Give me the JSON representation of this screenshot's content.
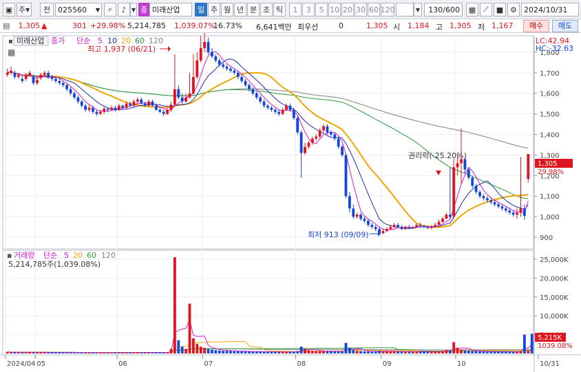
{
  "toolbar": {
    "type_label": "주",
    "jeon_label": "전",
    "code": "025560",
    "stock_badge": "종",
    "stock_name": "미래산업",
    "periods": [
      "일",
      "주",
      "월",
      "년",
      "분",
      "초",
      "틱"
    ],
    "numbers": [
      "1",
      "3",
      "5",
      "10",
      "20",
      "30",
      "60",
      "120"
    ],
    "count": "130/600",
    "date": "2024/10/31"
  },
  "quote": {
    "price": "1,305",
    "change": "301",
    "change_pct": "+29.98%",
    "volume": "5,214,785",
    "volume_pct": "1,039.07%",
    "turnover_pct": "16.73%",
    "amount": "6,641백만",
    "preferred_label": "최우선",
    "preferred_value": "0",
    "best_price": "1,305",
    "open_label": "시",
    "open": "1,184",
    "high_label": "고",
    "high": "1,305",
    "low_label": "저",
    "low": "1,167",
    "buy_label": "매수",
    "sell_label": "매도"
  },
  "price_panel": {
    "name_label": "미래산업",
    "ma_title": "종가",
    "ma_kind": "단순",
    "ma_periods": [
      "5",
      "10",
      "20",
      "60",
      "120"
    ],
    "lc": "LC:42.94",
    "hc": "HC:-32.63",
    "high_note": "최고 1,937 (06/21)",
    "low_note": "최저 913 (09/09)",
    "rights_note": "권리락(-25.20%)",
    "last_price_box": "1,305",
    "last_change_box": "29.98%"
  },
  "volume_panel": {
    "title": "거래량",
    "ma_kind": "단순",
    "ma_periods": [
      "5",
      "20",
      "60",
      "120"
    ],
    "info": "5,214,785주(1,039.08%)",
    "last_box": "5,215K",
    "last_pct_box": "1039.08%"
  },
  "colors": {
    "up": "#e0141e",
    "down": "#1446d8",
    "ma5": "#d21bd2",
    "ma10": "#1a2ea8",
    "ma20": "#f0a500",
    "ma60": "#2a9a3a",
    "ma120": "#7f7f7f"
  },
  "chart_data": [
    {
      "type": "candlestick",
      "title": "미래산업",
      "y_ticks": [
        "1,800",
        "1,700",
        "1,600",
        "1,500",
        "1,400",
        "1,300",
        "1,200",
        "1,100",
        "1,000",
        "900"
      ],
      "ylim": [
        850,
        1860
      ],
      "x_ticks": [
        "2024/04",
        "05",
        "06",
        "07",
        "08",
        "09",
        "10",
        "10/31"
      ],
      "x_tick_index": [
        0,
        8,
        30,
        53,
        78,
        101,
        121,
        140
      ],
      "n": 141,
      "closes": [
        1700,
        1710,
        1680,
        1690,
        1660,
        1690,
        1700,
        1650,
        1665,
        1690,
        1700,
        1680,
        1670,
        1660,
        1650,
        1640,
        1620,
        1600,
        1580,
        1560,
        1540,
        1520,
        1530,
        1510,
        1500,
        1510,
        1525,
        1520,
        1530,
        1520,
        1540,
        1530,
        1550,
        1540,
        1560,
        1570,
        1550,
        1540,
        1560,
        1540,
        1520,
        1510,
        1500,
        1520,
        1545,
        1620,
        1580,
        1560,
        1580,
        1600,
        1680,
        1760,
        1820,
        1850,
        1800,
        1780,
        1760,
        1740,
        1730,
        1720,
        1710,
        1700,
        1680,
        1660,
        1640,
        1620,
        1600,
        1580,
        1560,
        1540,
        1530,
        1520,
        1510,
        1500,
        1520,
        1540,
        1520,
        1480,
        1410,
        1310,
        1340,
        1360,
        1380,
        1390,
        1420,
        1440,
        1410,
        1400,
        1380,
        1340,
        1300,
        1100,
        1040,
        1000,
        1010,
        990,
        980,
        960,
        950,
        940,
        920,
        930,
        940,
        950,
        960,
        950,
        940,
        950,
        945,
        950,
        960,
        955,
        950,
        945,
        950,
        960,
        975,
        990,
        1010,
        1000,
        1240,
        1260,
        1280,
        1230,
        1190,
        1150,
        1120,
        1100,
        1090,
        1080,
        1070,
        1060,
        1050,
        1040,
        1030,
        1020,
        1010,
        1020,
        1040,
        1004,
        1305
      ],
      "opens": [
        1690,
        1700,
        1700,
        1680,
        1670,
        1670,
        1690,
        1680,
        1650,
        1675,
        1690,
        1700,
        1680,
        1670,
        1660,
        1650,
        1640,
        1620,
        1600,
        1580,
        1560,
        1540,
        1520,
        1530,
        1510,
        1500,
        1510,
        1525,
        1520,
        1530,
        1520,
        1540,
        1530,
        1550,
        1540,
        1560,
        1570,
        1550,
        1540,
        1560,
        1540,
        1520,
        1510,
        1500,
        1520,
        1545,
        1620,
        1580,
        1560,
        1580,
        1600,
        1680,
        1760,
        1820,
        1850,
        1800,
        1780,
        1760,
        1740,
        1730,
        1720,
        1710,
        1700,
        1680,
        1660,
        1640,
        1620,
        1600,
        1580,
        1560,
        1540,
        1530,
        1520,
        1510,
        1500,
        1520,
        1540,
        1520,
        1480,
        1410,
        1310,
        1340,
        1360,
        1380,
        1390,
        1420,
        1440,
        1410,
        1400,
        1380,
        1340,
        1300,
        1100,
        1040,
        1000,
        1010,
        990,
        980,
        960,
        950,
        940,
        920,
        930,
        940,
        950,
        960,
        950,
        940,
        950,
        945,
        950,
        960,
        955,
        950,
        945,
        950,
        960,
        975,
        990,
        1010,
        1000,
        1240,
        1260,
        1280,
        1230,
        1190,
        1150,
        1120,
        1100,
        1090,
        1080,
        1070,
        1060,
        1050,
        1040,
        1030,
        1020,
        1010,
        1020,
        1040,
        1184
      ],
      "highs": [
        1720,
        1730,
        1710,
        1700,
        1690,
        1700,
        1710,
        1690,
        1680,
        1700,
        1710,
        1710,
        1690,
        1680,
        1670,
        1660,
        1650,
        1630,
        1610,
        1590,
        1570,
        1550,
        1545,
        1540,
        1520,
        1520,
        1535,
        1530,
        1540,
        1540,
        1550,
        1545,
        1560,
        1560,
        1570,
        1580,
        1580,
        1560,
        1570,
        1570,
        1550,
        1530,
        1520,
        1530,
        1560,
        1790,
        1640,
        1600,
        1600,
        1700,
        1790,
        1800,
        1880,
        1937,
        1870,
        1820,
        1790,
        1770,
        1750,
        1740,
        1730,
        1720,
        1710,
        1690,
        1670,
        1650,
        1630,
        1610,
        1590,
        1570,
        1550,
        1540,
        1530,
        1520,
        1530,
        1550,
        1550,
        1530,
        1490,
        1420,
        1360,
        1370,
        1390,
        1400,
        1430,
        1450,
        1450,
        1420,
        1410,
        1390,
        1350,
        1310,
        1120,
        1060,
        1020,
        1020,
        1000,
        990,
        970,
        960,
        950,
        940,
        950,
        960,
        970,
        970,
        960,
        955,
        960,
        955,
        965,
        970,
        960,
        955,
        960,
        970,
        985,
        1000,
        1020,
        1240,
        1280,
        1300,
        1430,
        1290,
        1240,
        1200,
        1160,
        1130,
        1110,
        1100,
        1090,
        1080,
        1070,
        1060,
        1050,
        1040,
        1030,
        1040,
        1290,
        1060,
        1305
      ],
      "lows": [
        1680,
        1690,
        1670,
        1670,
        1650,
        1660,
        1680,
        1640,
        1640,
        1665,
        1680,
        1670,
        1660,
        1650,
        1640,
        1630,
        1610,
        1590,
        1570,
        1550,
        1530,
        1510,
        1510,
        1500,
        1490,
        1495,
        1500,
        1510,
        1515,
        1510,
        1515,
        1525,
        1525,
        1535,
        1535,
        1545,
        1545,
        1535,
        1535,
        1535,
        1515,
        1505,
        1490,
        1495,
        1510,
        1540,
        1570,
        1550,
        1555,
        1575,
        1595,
        1670,
        1750,
        1800,
        1790,
        1770,
        1750,
        1730,
        1720,
        1710,
        1700,
        1690,
        1670,
        1650,
        1630,
        1610,
        1590,
        1570,
        1550,
        1530,
        1520,
        1510,
        1500,
        1490,
        1495,
        1515,
        1510,
        1470,
        1400,
        1190,
        1300,
        1330,
        1350,
        1370,
        1380,
        1410,
        1400,
        1390,
        1370,
        1330,
        1290,
        1090,
        1020,
        990,
        990,
        980,
        970,
        950,
        940,
        930,
        913,
        915,
        925,
        935,
        945,
        945,
        935,
        935,
        940,
        940,
        950,
        950,
        945,
        940,
        940,
        950,
        960,
        970,
        990,
        990,
        990,
        1200,
        1160,
        1210,
        1180,
        1140,
        1110,
        1090,
        1080,
        1070,
        1060,
        1050,
        1040,
        1030,
        1020,
        1010,
        1000,
        990,
        1000,
        985,
        1167
      ]
    },
    {
      "type": "bar",
      "title": "거래량",
      "y_ticks": [
        "25,000K",
        "20,000K",
        "15,000K",
        "10,000K",
        "5,000K"
      ],
      "ylim": [
        0,
        27000
      ],
      "values": [
        400,
        300,
        350,
        300,
        250,
        300,
        320,
        280,
        300,
        280,
        260,
        280,
        300,
        280,
        260,
        250,
        240,
        230,
        220,
        230,
        240,
        230,
        220,
        230,
        220,
        210,
        220,
        230,
        240,
        230,
        250,
        240,
        260,
        250,
        270,
        280,
        260,
        250,
        270,
        260,
        250,
        240,
        260,
        280,
        1200,
        25500,
        3500,
        1800,
        1200,
        13200,
        4000,
        2500,
        1800,
        1500,
        1200,
        1000,
        900,
        800,
        700,
        700,
        650,
        600,
        600,
        550,
        520,
        500,
        480,
        470,
        460,
        450,
        440,
        430,
        420,
        410,
        420,
        430,
        420,
        400,
        600,
        1800,
        1200,
        800,
        700,
        650,
        600,
        580,
        560,
        540,
        520,
        500,
        480,
        2800,
        1500,
        900,
        700,
        600,
        550,
        500,
        450,
        500,
        700,
        600,
        550,
        500,
        480,
        470,
        460,
        450,
        460,
        470,
        480,
        470,
        460,
        450,
        460,
        480,
        500,
        600,
        900,
        800,
        3000,
        1500,
        1000,
        800,
        700,
        650,
        600,
        550,
        520,
        500,
        480,
        460,
        450,
        440,
        430,
        420,
        410,
        400,
        600,
        5000,
        700,
        5215
      ]
    }
  ]
}
